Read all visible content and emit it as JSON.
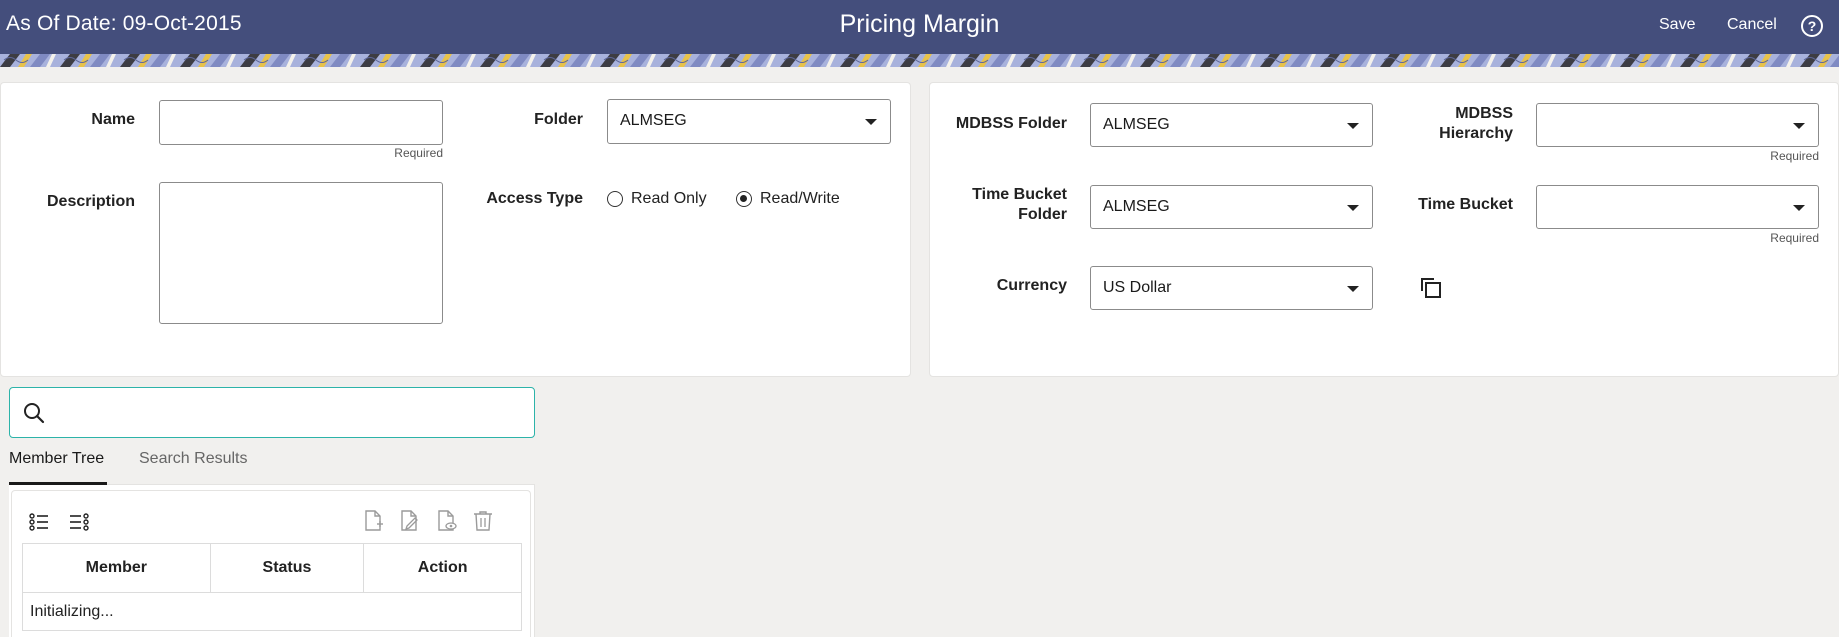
{
  "header": {
    "as_of_date": "As Of Date: 09-Oct-2015",
    "title": "Pricing Margin",
    "save_label": "Save",
    "cancel_label": "Cancel",
    "help_icon": "?"
  },
  "colors": {
    "header_bg": "#444e7c",
    "search_border": "#2cb3a9"
  },
  "left_form": {
    "name_label": "Name",
    "name_value": "",
    "name_required": "Required",
    "description_label": "Description",
    "description_value": "",
    "folder_label": "Folder",
    "folder_value": "ALMSEG",
    "access_type_label": "Access Type",
    "access_options": [
      {
        "label": "Read Only",
        "selected": false
      },
      {
        "label": "Read/Write",
        "selected": true
      }
    ]
  },
  "right_form": {
    "mdbss_folder_label": "MDBSS Folder",
    "mdbss_folder_value": "ALMSEG",
    "mdbss_hierarchy_label": "MDBSS Hierarchy",
    "mdbss_hierarchy_value": "",
    "mdbss_hierarchy_required": "Required",
    "time_bucket_folder_label": "Time Bucket Folder",
    "time_bucket_folder_value": "ALMSEG",
    "time_bucket_label": "Time Bucket",
    "time_bucket_value": "",
    "time_bucket_required": "Required",
    "currency_label": "Currency",
    "currency_value": "US Dollar"
  },
  "search": {
    "placeholder": "",
    "value": ""
  },
  "tabs": [
    {
      "label": "Member Tree",
      "active": true
    },
    {
      "label": "Search Results",
      "active": false
    }
  ],
  "tree_table": {
    "columns": [
      "Member",
      "Status",
      "Action"
    ],
    "status_text": "Initializing..."
  }
}
